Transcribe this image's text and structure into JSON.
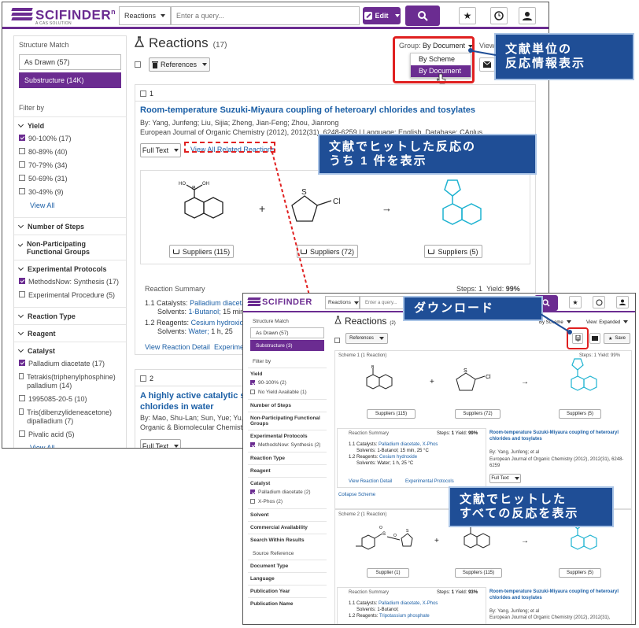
{
  "app": {
    "logo": "SCIFINDER",
    "logo_sup": "n",
    "logo_sub": "A CAS SOLUTION"
  },
  "search": {
    "type": "Reactions",
    "placeholder": "Enter a query...",
    "edit_label": "Edit"
  },
  "sidebar": {
    "structure_match": "Structure Match",
    "as_drawn": "As Drawn (57)",
    "substructure": "Substructure (14K)",
    "filter_by": "Filter by",
    "yield_header": "Yield",
    "yield_items": [
      "90-100% (17)",
      "80-89% (40)",
      "70-79% (34)",
      "50-69% (31)",
      "30-49% (9)"
    ],
    "view_all": "View All",
    "number_of_steps": "Number of Steps",
    "non_participating": "Non-Participating Functional Groups",
    "experimental_protocols": "Experimental Protocols",
    "protocol_items": [
      "MethodsNow: Synthesis (17)",
      "Experimental Procedure (5)"
    ],
    "reaction_type": "Reaction Type",
    "reagent": "Reagent",
    "catalyst": "Catalyst",
    "catalyst_items": [
      "Palladium diacetate (17)",
      "Tetrakis(triphenylphosphine) palladium (14)",
      "1995085-20-5 (10)",
      "Tris(dibenzylideneacetone) dipalladium (7)",
      "Pivalic acid (5)"
    ],
    "view_all_2": "View All"
  },
  "main": {
    "heading": "Reactions",
    "count": "(17)",
    "group_label": "Group:",
    "group_value": "By Document",
    "view_label": "View:",
    "group_options": [
      "By Scheme",
      "By Document"
    ],
    "references_btn": "References",
    "result1": {
      "num": "1",
      "title": "Room-temperature Suzuki-Miyaura coupling of heteroaryl chlorides and tosylates",
      "authors": "By: Yang, Junfeng; Liu, Sijia; Zheng, Jian-Feng; Zhou, Jianrong",
      "source": "European Journal of Organic Chemistry (2012), 2012(31), 6248-6259 | Language: English, Database: CAplus",
      "full_text": "Full Text",
      "view_related": "View All Related Reactions",
      "suppliers": [
        "Suppliers (115)",
        "Suppliers (72)",
        "Suppliers (5)"
      ],
      "reaction_summary": "Reaction Summary",
      "steps_label": "Steps:",
      "steps_value": "1",
      "yield_label": "Yield:",
      "yield_value": "99%",
      "line1_num": "1.1",
      "line1_label": "Catalysts:",
      "line1_value": "Palladium diacetate",
      "line1b": "Solvents:",
      "line1b_value": "1-Butanol;",
      "line1b_tail": "15 min,",
      "line2_num": "1.2",
      "line2_label": "Reagents:",
      "line2_value": "Cesium hydroxide",
      "line2b": "Solvents:",
      "line2b_value": "Water;",
      "line2b_tail": "1 h, 25",
      "view_detail": "View Reaction Detail",
      "experim": "Experimen"
    },
    "result2": {
      "num": "2",
      "title": "A highly active catalytic sys chlorides in water",
      "authors": "By: Mao, Shu-Lan; Sun, Yue; Yu, Gu",
      "source": "Organic & Biomolecular Chemistry",
      "full_text": "Full Text"
    }
  },
  "callouts": {
    "doc_unit": [
      "文献単位の",
      "反応情報表示"
    ],
    "one_hit": [
      "文献でヒットした反応の",
      "うち 1 件を表示"
    ],
    "download": "ダウンロード",
    "all_hit": [
      "文献でヒットした",
      "すべての反応を表示"
    ]
  },
  "overlay": {
    "heading": "Reactions",
    "count": "(2)",
    "group_value": "By Scheme",
    "view_label": "View:",
    "view_value": "Expanded",
    "save": "Save",
    "references_btn": "References",
    "sidebar": {
      "structure_match": "Structure Match",
      "as_drawn": "As Drawn (57)",
      "substructure": "Substructure (3)",
      "filter_by": "Filter by",
      "yield": "Yield",
      "yield_items": [
        "90-100% (2)",
        "No Yield Available (1)"
      ],
      "number_of_steps": "Number of Steps",
      "non_participating": "Non-Participating Functional Groups",
      "experimental_protocols": "Experimental Protocols",
      "protocol_item": "MethodsNow: Synthesis (2)",
      "reaction_type": "Reaction Type",
      "reagent": "Reagent",
      "catalyst": "Catalyst",
      "catalyst_items": [
        "Palladium diacetate (2)",
        "X-Phos (2)"
      ],
      "solvent": "Solvent",
      "commercial": "Commercial Availability",
      "search_within": "Search Within Results",
      "source_reference": "Source Reference",
      "document_type": "Document Type",
      "language": "Language",
      "publication_year": "Publication Year",
      "publication_name": "Publication Name"
    },
    "scheme1": {
      "label": "Scheme 1 (1 Reaction)",
      "steps": "Steps: 1",
      "yield": "Yield: 99%",
      "suppliers": [
        "Suppliers (115)",
        "Suppliers (72)",
        "Suppliers (5)"
      ],
      "summary": "Reaction Summary",
      "summary_steps": "Steps:",
      "summary_steps_v": "1",
      "summary_yield": "Yield:",
      "summary_yield_v": "99%",
      "l1": "1.1",
      "l1_label": "Catalysts:",
      "l1_value": "Palladium diacetate, X-Phos",
      "l1b": "Solvents: 1-Butanol; 15 min, 25 °C",
      "l2": "1.2",
      "l2_label": "Reagents:",
      "l2_value": "Cesium hydroxide",
      "l2b": "Solvents: Water; 1 h, 25 °C",
      "view_detail": "View Reaction Detail",
      "exp_protocols": "Experimental Protocols",
      "title": "Room-temperature Suzuki-Miyaura coupling of heteroaryl chlorides and tosylates",
      "by": "By: Yang, Junfeng; et al",
      "source": "European Journal of Organic Chemistry (2012), 2012(31), 6248-6259",
      "full_text": "Full Text",
      "collapse": "Collapse Scheme"
    },
    "scheme2": {
      "label": "Scheme 2 (1 Reaction)",
      "suppliers": [
        "Supplier (1)",
        "Suppliers (115)",
        "Suppliers (5)"
      ],
      "summary": "Reaction Summary",
      "summary_steps": "Steps:",
      "summary_steps_v": "1",
      "summary_yield": "Yield:",
      "summary_yield_v": "93%",
      "l1": "1.1",
      "l1_label": "Catalysts:",
      "l1_value": "Palladium diacetate, X-Phos",
      "l1b": "Solvents: 1-Butanol;",
      "l2": "1.2",
      "l2_label": "Reagents:",
      "l2_value": "Tripotassium phosphate",
      "title": "Room-temperature Suzuki-Miyaura coupling of heteroaryl chlorides and tosylates",
      "by": "By: Yang, Junfeng; et al",
      "source": "European Journal of Organic Chemistry (2012), 2012(31),"
    }
  },
  "colors": {
    "brand": "#6b2c91",
    "link": "#1b5fa6",
    "callout": "#1f4e96",
    "highlight": "#e02020",
    "product": "#1fb3d1"
  }
}
